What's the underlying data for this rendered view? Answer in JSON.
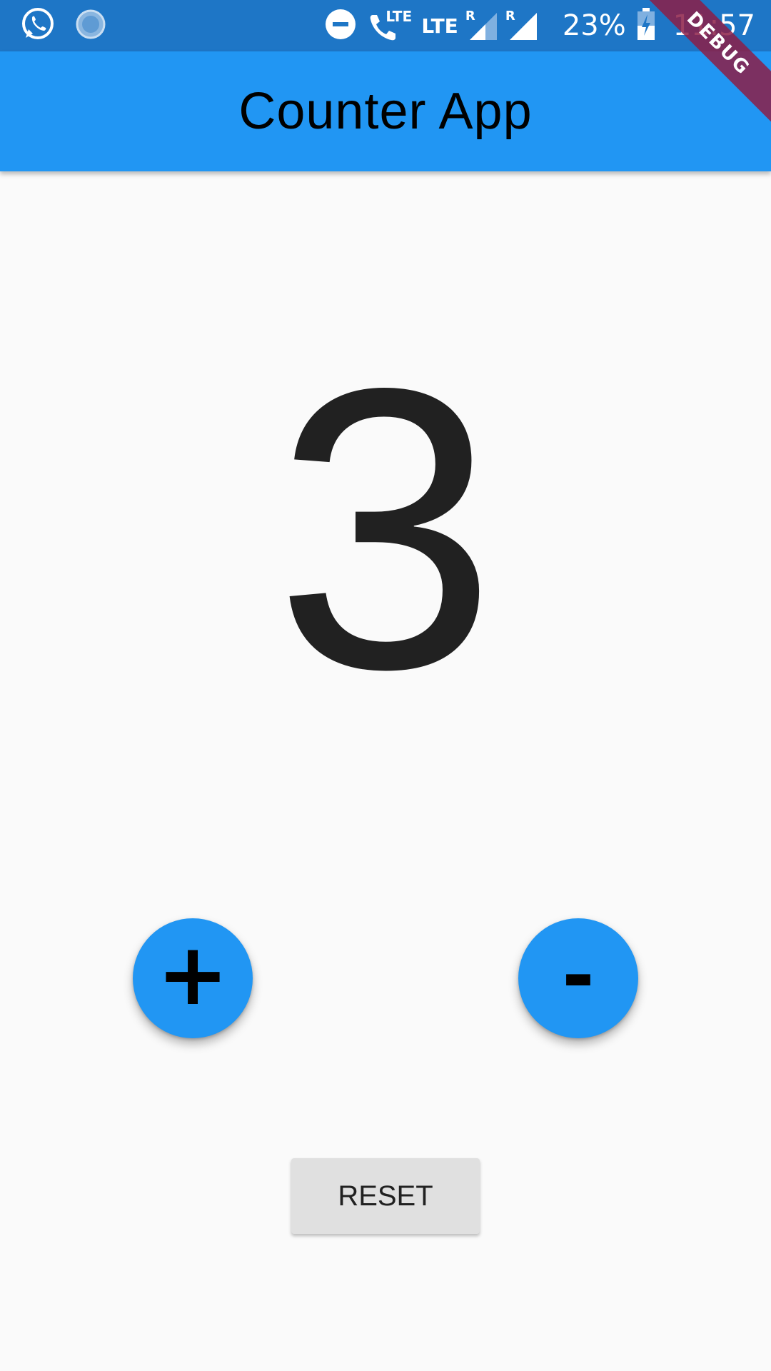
{
  "status_bar": {
    "battery": "23%",
    "time": "11:57",
    "lte_call_label": "LTE",
    "lte_label": "LTE",
    "roaming_label_1": "R",
    "roaming_label_2": "R",
    "icons": [
      "whatsapp-icon",
      "loading-icon",
      "do-not-disturb-icon",
      "volte-call-icon",
      "signal-icon",
      "signal-icon",
      "battery-charging-icon"
    ]
  },
  "app_bar": {
    "title": "Counter App"
  },
  "debug_banner": "DEBUG",
  "counter": {
    "value": "3"
  },
  "buttons": {
    "increment_label": "+",
    "decrement_label": "-",
    "reset_label": "RESET"
  },
  "colors": {
    "status_bar": "#1e76c6",
    "primary": "#2196f3",
    "background": "#fafafa",
    "reset_button": "#e0e0e0",
    "counter_text": "#212121",
    "debug_banner": "#8c1e46"
  }
}
